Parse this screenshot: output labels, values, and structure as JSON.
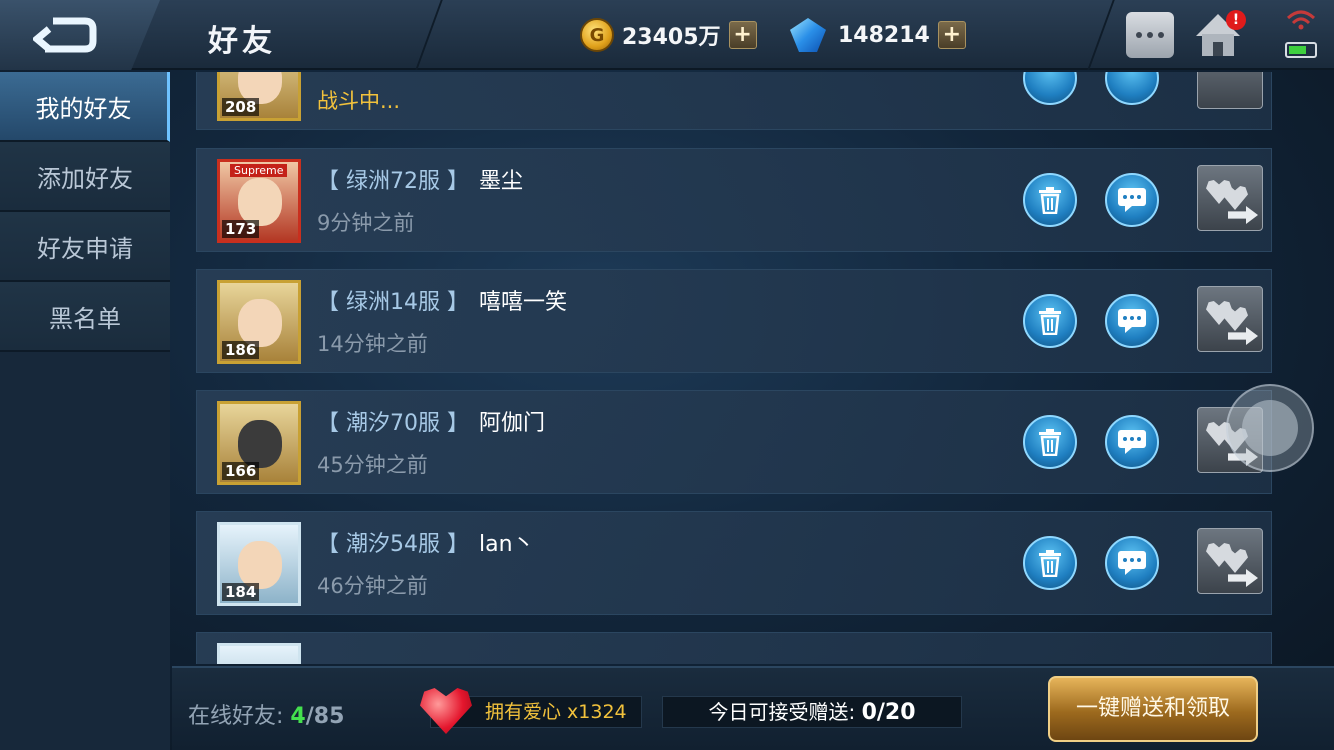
{
  "header": {
    "title": "好友",
    "gold_value": "23405万",
    "gold_coin_letter": "G",
    "gem_value": "148214",
    "plus_symbol": "+",
    "alert_symbol": "!"
  },
  "sidebar": {
    "items": [
      {
        "label": "我的好友",
        "active": true
      },
      {
        "label": "添加好友",
        "active": false
      },
      {
        "label": "好友申请",
        "active": false
      },
      {
        "label": "黑名单",
        "active": false
      }
    ]
  },
  "friends": [
    {
      "level": "208",
      "server": "",
      "name": "",
      "status": "战斗中..."
    },
    {
      "level": "173",
      "tag": "Supreme",
      "server": "【 绿洲72服 】",
      "name": "墨尘",
      "status": "9分钟之前"
    },
    {
      "level": "186",
      "server": "【 绿洲14服 】",
      "name": "嘻嘻一笑",
      "status": "14分钟之前"
    },
    {
      "level": "166",
      "server": "【 潮汐70服 】",
      "name": "阿伽门",
      "status": "45分钟之前"
    },
    {
      "level": "184",
      "server": "【 潮汐54服 】",
      "name": "lan丶",
      "status": "46分钟之前"
    }
  ],
  "footer": {
    "online_label": "在线好友:",
    "online_count": "4",
    "online_total": "/85",
    "love_text": "拥有爱心 x1324",
    "accept_label": "今日可接受赠送:",
    "accept_value": "0/20",
    "oneclick_label": "一键赠送和领取"
  },
  "colors": {
    "accent_blue": "#6ec2ff",
    "online_green": "#44e04e",
    "gold_text": "#f2c23c",
    "heart_red": "#e4162d"
  }
}
